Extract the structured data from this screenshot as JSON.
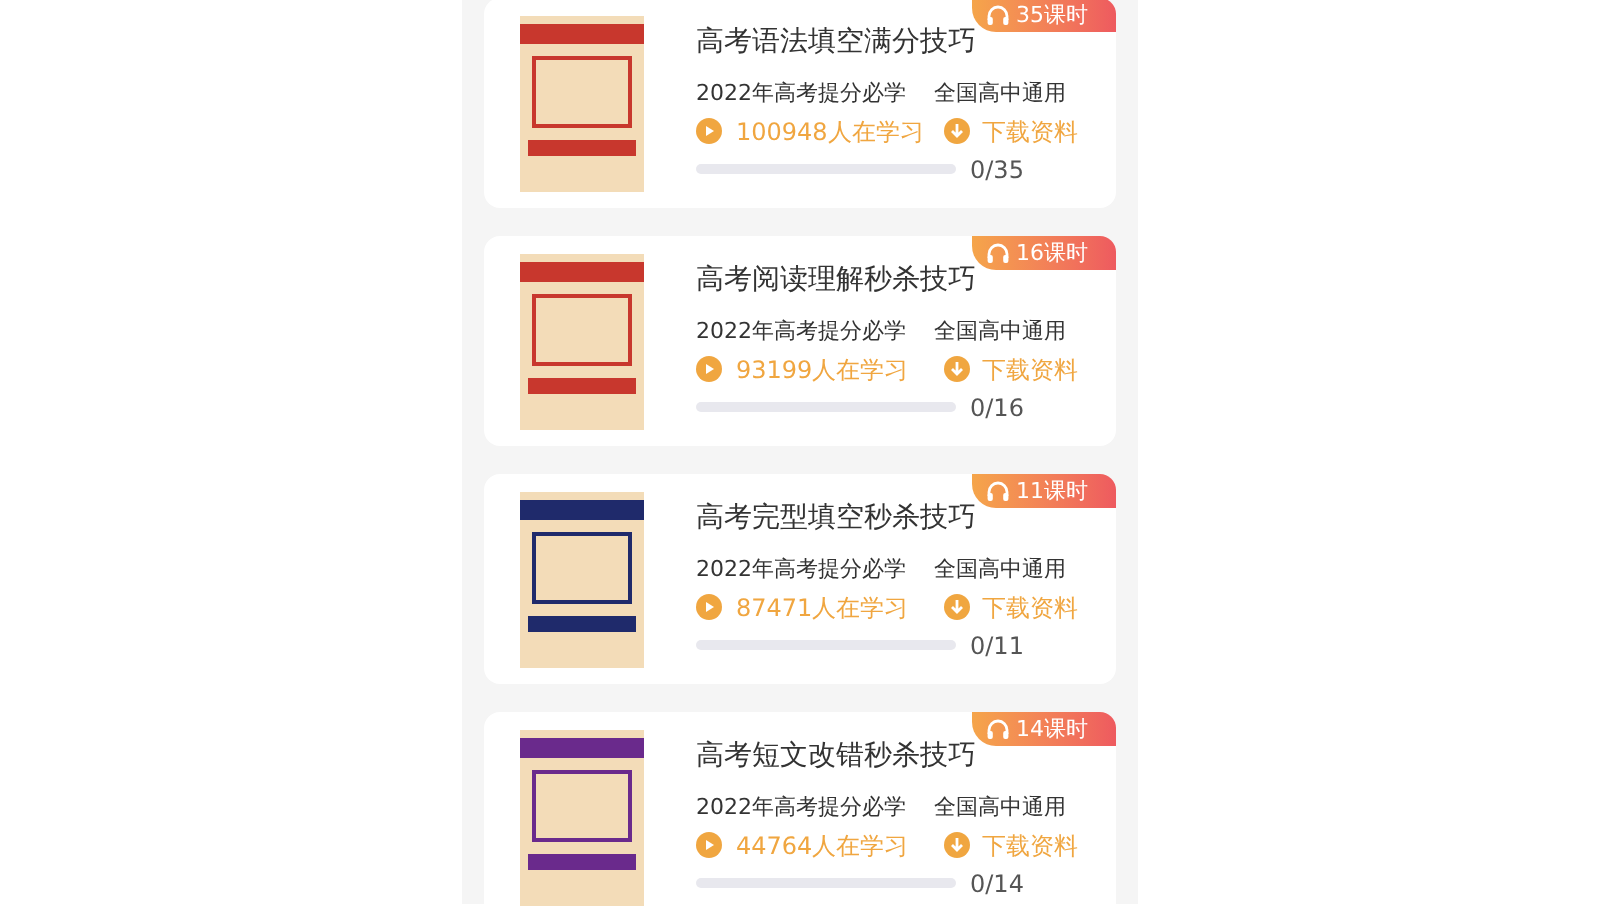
{
  "courses": [
    {
      "badge": "35课时",
      "title": "高考语法填空满分技巧",
      "subtitle": "2022年高考提分必学",
      "scope": "全国高中通用",
      "learners": "100948人在学习",
      "download": "下载资料",
      "progress": "0/35",
      "level": 0,
      "color": "#c8372d"
    },
    {
      "badge": "16课时",
      "title": "高考阅读理解秒杀技巧",
      "subtitle": "2022年高考提分必学",
      "scope": "全国高中通用",
      "learners": "93199人在学习",
      "download": "下载资料",
      "progress": "0/16",
      "level": 0,
      "color": "#c8372d"
    },
    {
      "badge": "11课时",
      "title": "高考完型填空秒杀技巧",
      "subtitle": "2022年高考提分必学",
      "scope": "全国高中通用",
      "learners": "87471人在学习",
      "download": "下载资料",
      "progress": "0/11",
      "level": 0,
      "color": "#1f2a6b"
    },
    {
      "badge": "14课时",
      "title": "高考短文改错秒杀技巧",
      "subtitle": "2022年高考提分必学",
      "scope": "全国高中通用",
      "learners": "44764人在学习",
      "download": "下载资料",
      "progress": "0/14",
      "level": 0,
      "color": "#6a2a8c"
    }
  ]
}
